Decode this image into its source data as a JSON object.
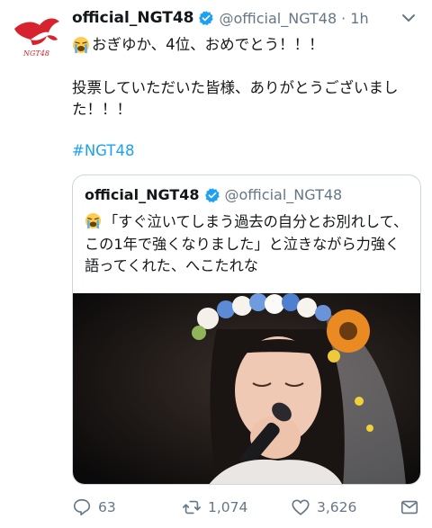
{
  "tweet": {
    "author_name": "official_NGT48",
    "handle": "@official_NGT48",
    "separator": "·",
    "time": "1h",
    "text_line1": "おぎゆか、4位、おめでとう！！！",
    "text_line2": "投票していただいた皆様、ありがとうございました！！！",
    "hashtag": "#NGT48",
    "avatar_logo_text": "NGT48"
  },
  "quoted": {
    "author_name": "official_NGT48",
    "handle": "@official_NGT48",
    "text": "「すぐ泣いてしまう過去の自分とお別れして、この1年で強くなりました」と泣きながら力強く語ってくれた、へこたれな"
  },
  "actions": {
    "replies": "63",
    "retweets": "1,074",
    "likes": "3,626"
  },
  "colors": {
    "accent": "#1da1f2",
    "secondary_text": "#657786",
    "brand_red": "#d7232d"
  }
}
